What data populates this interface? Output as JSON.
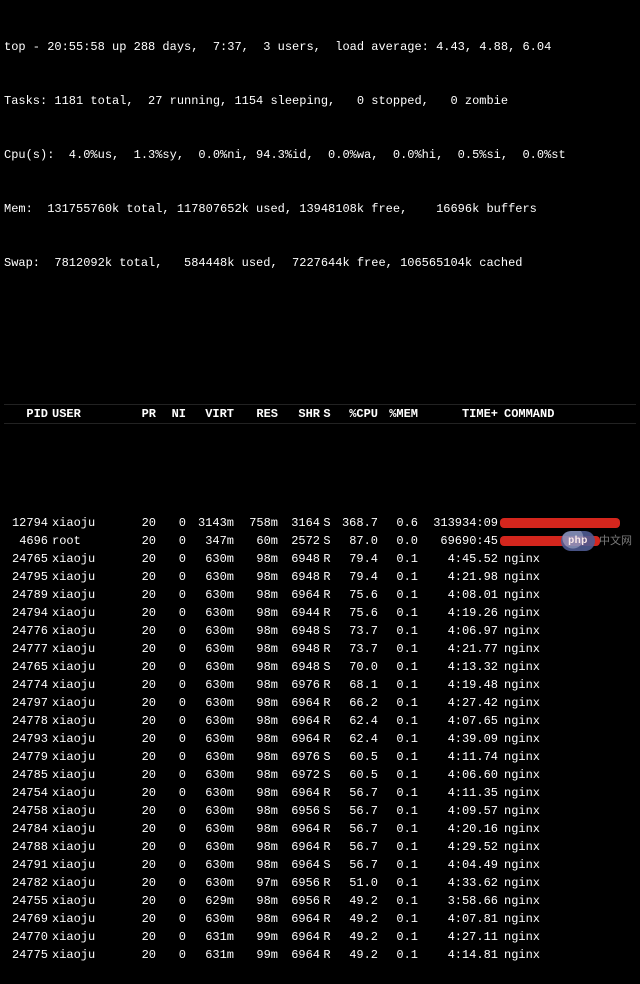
{
  "summary": {
    "line1": "top - 20:55:58 up 288 days,  7:37,  3 users,  load average: 4.43, 4.88, 6.04",
    "line2": "Tasks: 1181 total,  27 running, 1154 sleeping,   0 stopped,   0 zombie",
    "line3": "Cpu(s):  4.0%us,  1.3%sy,  0.0%ni, 94.3%id,  0.0%wa,  0.0%hi,  0.5%si,  0.0%st",
    "line4": "Mem:  131755760k total, 117807652k used, 13948108k free,    16696k buffers",
    "line5": "Swap:  7812092k total,   584448k used,  7227644k free, 106565104k cached"
  },
  "columns": {
    "pid": "PID",
    "user": "USER",
    "pr": "PR",
    "ni": "NI",
    "virt": "VIRT",
    "res": "RES",
    "shr": "SHR",
    "s": "S",
    "cpu": "%CPU",
    "mem": "%MEM",
    "time": "TIME+",
    "cmd": "COMMAND"
  },
  "rows": [
    {
      "pid": "12794",
      "user": "xiaoju",
      "pr": "20",
      "ni": "0",
      "virt": "3143m",
      "res": "758m",
      "shr": "3164",
      "s": "S",
      "cpu": "368.7",
      "mem": "0.6",
      "time": "313934:09",
      "cmd": "",
      "redact": true,
      "rw": 120
    },
    {
      "pid": "4696",
      "user": "root",
      "pr": "20",
      "ni": "0",
      "virt": "347m",
      "res": "60m",
      "shr": "2572",
      "s": "S",
      "cpu": "87.0",
      "mem": "0.0",
      "time": "69690:45",
      "cmd": "",
      "redact": true,
      "rw": 100
    },
    {
      "pid": "24765",
      "user": "xiaoju",
      "pr": "20",
      "ni": "0",
      "virt": "630m",
      "res": "98m",
      "shr": "6948",
      "s": "R",
      "cpu": "79.4",
      "mem": "0.1",
      "time": "4:45.52",
      "cmd": "nginx"
    },
    {
      "pid": "24795",
      "user": "xiaoju",
      "pr": "20",
      "ni": "0",
      "virt": "630m",
      "res": "98m",
      "shr": "6948",
      "s": "R",
      "cpu": "79.4",
      "mem": "0.1",
      "time": "4:21.98",
      "cmd": "nginx"
    },
    {
      "pid": "24789",
      "user": "xiaoju",
      "pr": "20",
      "ni": "0",
      "virt": "630m",
      "res": "98m",
      "shr": "6964",
      "s": "R",
      "cpu": "75.6",
      "mem": "0.1",
      "time": "4:08.01",
      "cmd": "nginx"
    },
    {
      "pid": "24794",
      "user": "xiaoju",
      "pr": "20",
      "ni": "0",
      "virt": "630m",
      "res": "98m",
      "shr": "6944",
      "s": "R",
      "cpu": "75.6",
      "mem": "0.1",
      "time": "4:19.26",
      "cmd": "nginx"
    },
    {
      "pid": "24776",
      "user": "xiaoju",
      "pr": "20",
      "ni": "0",
      "virt": "630m",
      "res": "98m",
      "shr": "6948",
      "s": "S",
      "cpu": "73.7",
      "mem": "0.1",
      "time": "4:06.97",
      "cmd": "nginx"
    },
    {
      "pid": "24777",
      "user": "xiaoju",
      "pr": "20",
      "ni": "0",
      "virt": "630m",
      "res": "98m",
      "shr": "6948",
      "s": "R",
      "cpu": "73.7",
      "mem": "0.1",
      "time": "4:21.77",
      "cmd": "nginx"
    },
    {
      "pid": "24765",
      "user": "xiaoju",
      "pr": "20",
      "ni": "0",
      "virt": "630m",
      "res": "98m",
      "shr": "6948",
      "s": "S",
      "cpu": "70.0",
      "mem": "0.1",
      "time": "4:13.32",
      "cmd": "nginx"
    },
    {
      "pid": "24774",
      "user": "xiaoju",
      "pr": "20",
      "ni": "0",
      "virt": "630m",
      "res": "98m",
      "shr": "6976",
      "s": "R",
      "cpu": "68.1",
      "mem": "0.1",
      "time": "4:19.48",
      "cmd": "nginx"
    },
    {
      "pid": "24797",
      "user": "xiaoju",
      "pr": "20",
      "ni": "0",
      "virt": "630m",
      "res": "98m",
      "shr": "6964",
      "s": "R",
      "cpu": "66.2",
      "mem": "0.1",
      "time": "4:27.42",
      "cmd": "nginx"
    },
    {
      "pid": "24778",
      "user": "xiaoju",
      "pr": "20",
      "ni": "0",
      "virt": "630m",
      "res": "98m",
      "shr": "6964",
      "s": "R",
      "cpu": "62.4",
      "mem": "0.1",
      "time": "4:07.65",
      "cmd": "nginx"
    },
    {
      "pid": "24793",
      "user": "xiaoju",
      "pr": "20",
      "ni": "0",
      "virt": "630m",
      "res": "98m",
      "shr": "6964",
      "s": "R",
      "cpu": "62.4",
      "mem": "0.1",
      "time": "4:39.09",
      "cmd": "nginx"
    },
    {
      "pid": "24779",
      "user": "xiaoju",
      "pr": "20",
      "ni": "0",
      "virt": "630m",
      "res": "98m",
      "shr": "6976",
      "s": "S",
      "cpu": "60.5",
      "mem": "0.1",
      "time": "4:11.74",
      "cmd": "nginx"
    },
    {
      "pid": "24785",
      "user": "xiaoju",
      "pr": "20",
      "ni": "0",
      "virt": "630m",
      "res": "98m",
      "shr": "6972",
      "s": "S",
      "cpu": "60.5",
      "mem": "0.1",
      "time": "4:06.60",
      "cmd": "nginx"
    },
    {
      "pid": "24754",
      "user": "xiaoju",
      "pr": "20",
      "ni": "0",
      "virt": "630m",
      "res": "98m",
      "shr": "6964",
      "s": "R",
      "cpu": "56.7",
      "mem": "0.1",
      "time": "4:11.35",
      "cmd": "nginx"
    },
    {
      "pid": "24758",
      "user": "xiaoju",
      "pr": "20",
      "ni": "0",
      "virt": "630m",
      "res": "98m",
      "shr": "6956",
      "s": "S",
      "cpu": "56.7",
      "mem": "0.1",
      "time": "4:09.57",
      "cmd": "nginx"
    },
    {
      "pid": "24784",
      "user": "xiaoju",
      "pr": "20",
      "ni": "0",
      "virt": "630m",
      "res": "98m",
      "shr": "6964",
      "s": "R",
      "cpu": "56.7",
      "mem": "0.1",
      "time": "4:20.16",
      "cmd": "nginx"
    },
    {
      "pid": "24788",
      "user": "xiaoju",
      "pr": "20",
      "ni": "0",
      "virt": "630m",
      "res": "98m",
      "shr": "6964",
      "s": "R",
      "cpu": "56.7",
      "mem": "0.1",
      "time": "4:29.52",
      "cmd": "nginx"
    },
    {
      "pid": "24791",
      "user": "xiaoju",
      "pr": "20",
      "ni": "0",
      "virt": "630m",
      "res": "98m",
      "shr": "6964",
      "s": "S",
      "cpu": "56.7",
      "mem": "0.1",
      "time": "4:04.49",
      "cmd": "nginx"
    },
    {
      "pid": "24782",
      "user": "xiaoju",
      "pr": "20",
      "ni": "0",
      "virt": "630m",
      "res": "97m",
      "shr": "6956",
      "s": "R",
      "cpu": "51.0",
      "mem": "0.1",
      "time": "4:33.62",
      "cmd": "nginx"
    },
    {
      "pid": "24755",
      "user": "xiaoju",
      "pr": "20",
      "ni": "0",
      "virt": "629m",
      "res": "98m",
      "shr": "6956",
      "s": "R",
      "cpu": "49.2",
      "mem": "0.1",
      "time": "3:58.66",
      "cmd": "nginx"
    },
    {
      "pid": "24769",
      "user": "xiaoju",
      "pr": "20",
      "ni": "0",
      "virt": "630m",
      "res": "98m",
      "shr": "6964",
      "s": "R",
      "cpu": "49.2",
      "mem": "0.1",
      "time": "4:07.81",
      "cmd": "nginx"
    },
    {
      "pid": "24770",
      "user": "xiaoju",
      "pr": "20",
      "ni": "0",
      "virt": "631m",
      "res": "99m",
      "shr": "6964",
      "s": "R",
      "cpu": "49.2",
      "mem": "0.1",
      "time": "4:27.11",
      "cmd": "nginx"
    },
    {
      "pid": "24775",
      "user": "xiaoju",
      "pr": "20",
      "ni": "0",
      "virt": "631m",
      "res": "99m",
      "shr": "6964",
      "s": "R",
      "cpu": "49.2",
      "mem": "0.1",
      "time": "4:14.81",
      "cmd": "nginx"
    }
  ],
  "watermark": {
    "logo": "php",
    "text": "中文网"
  }
}
